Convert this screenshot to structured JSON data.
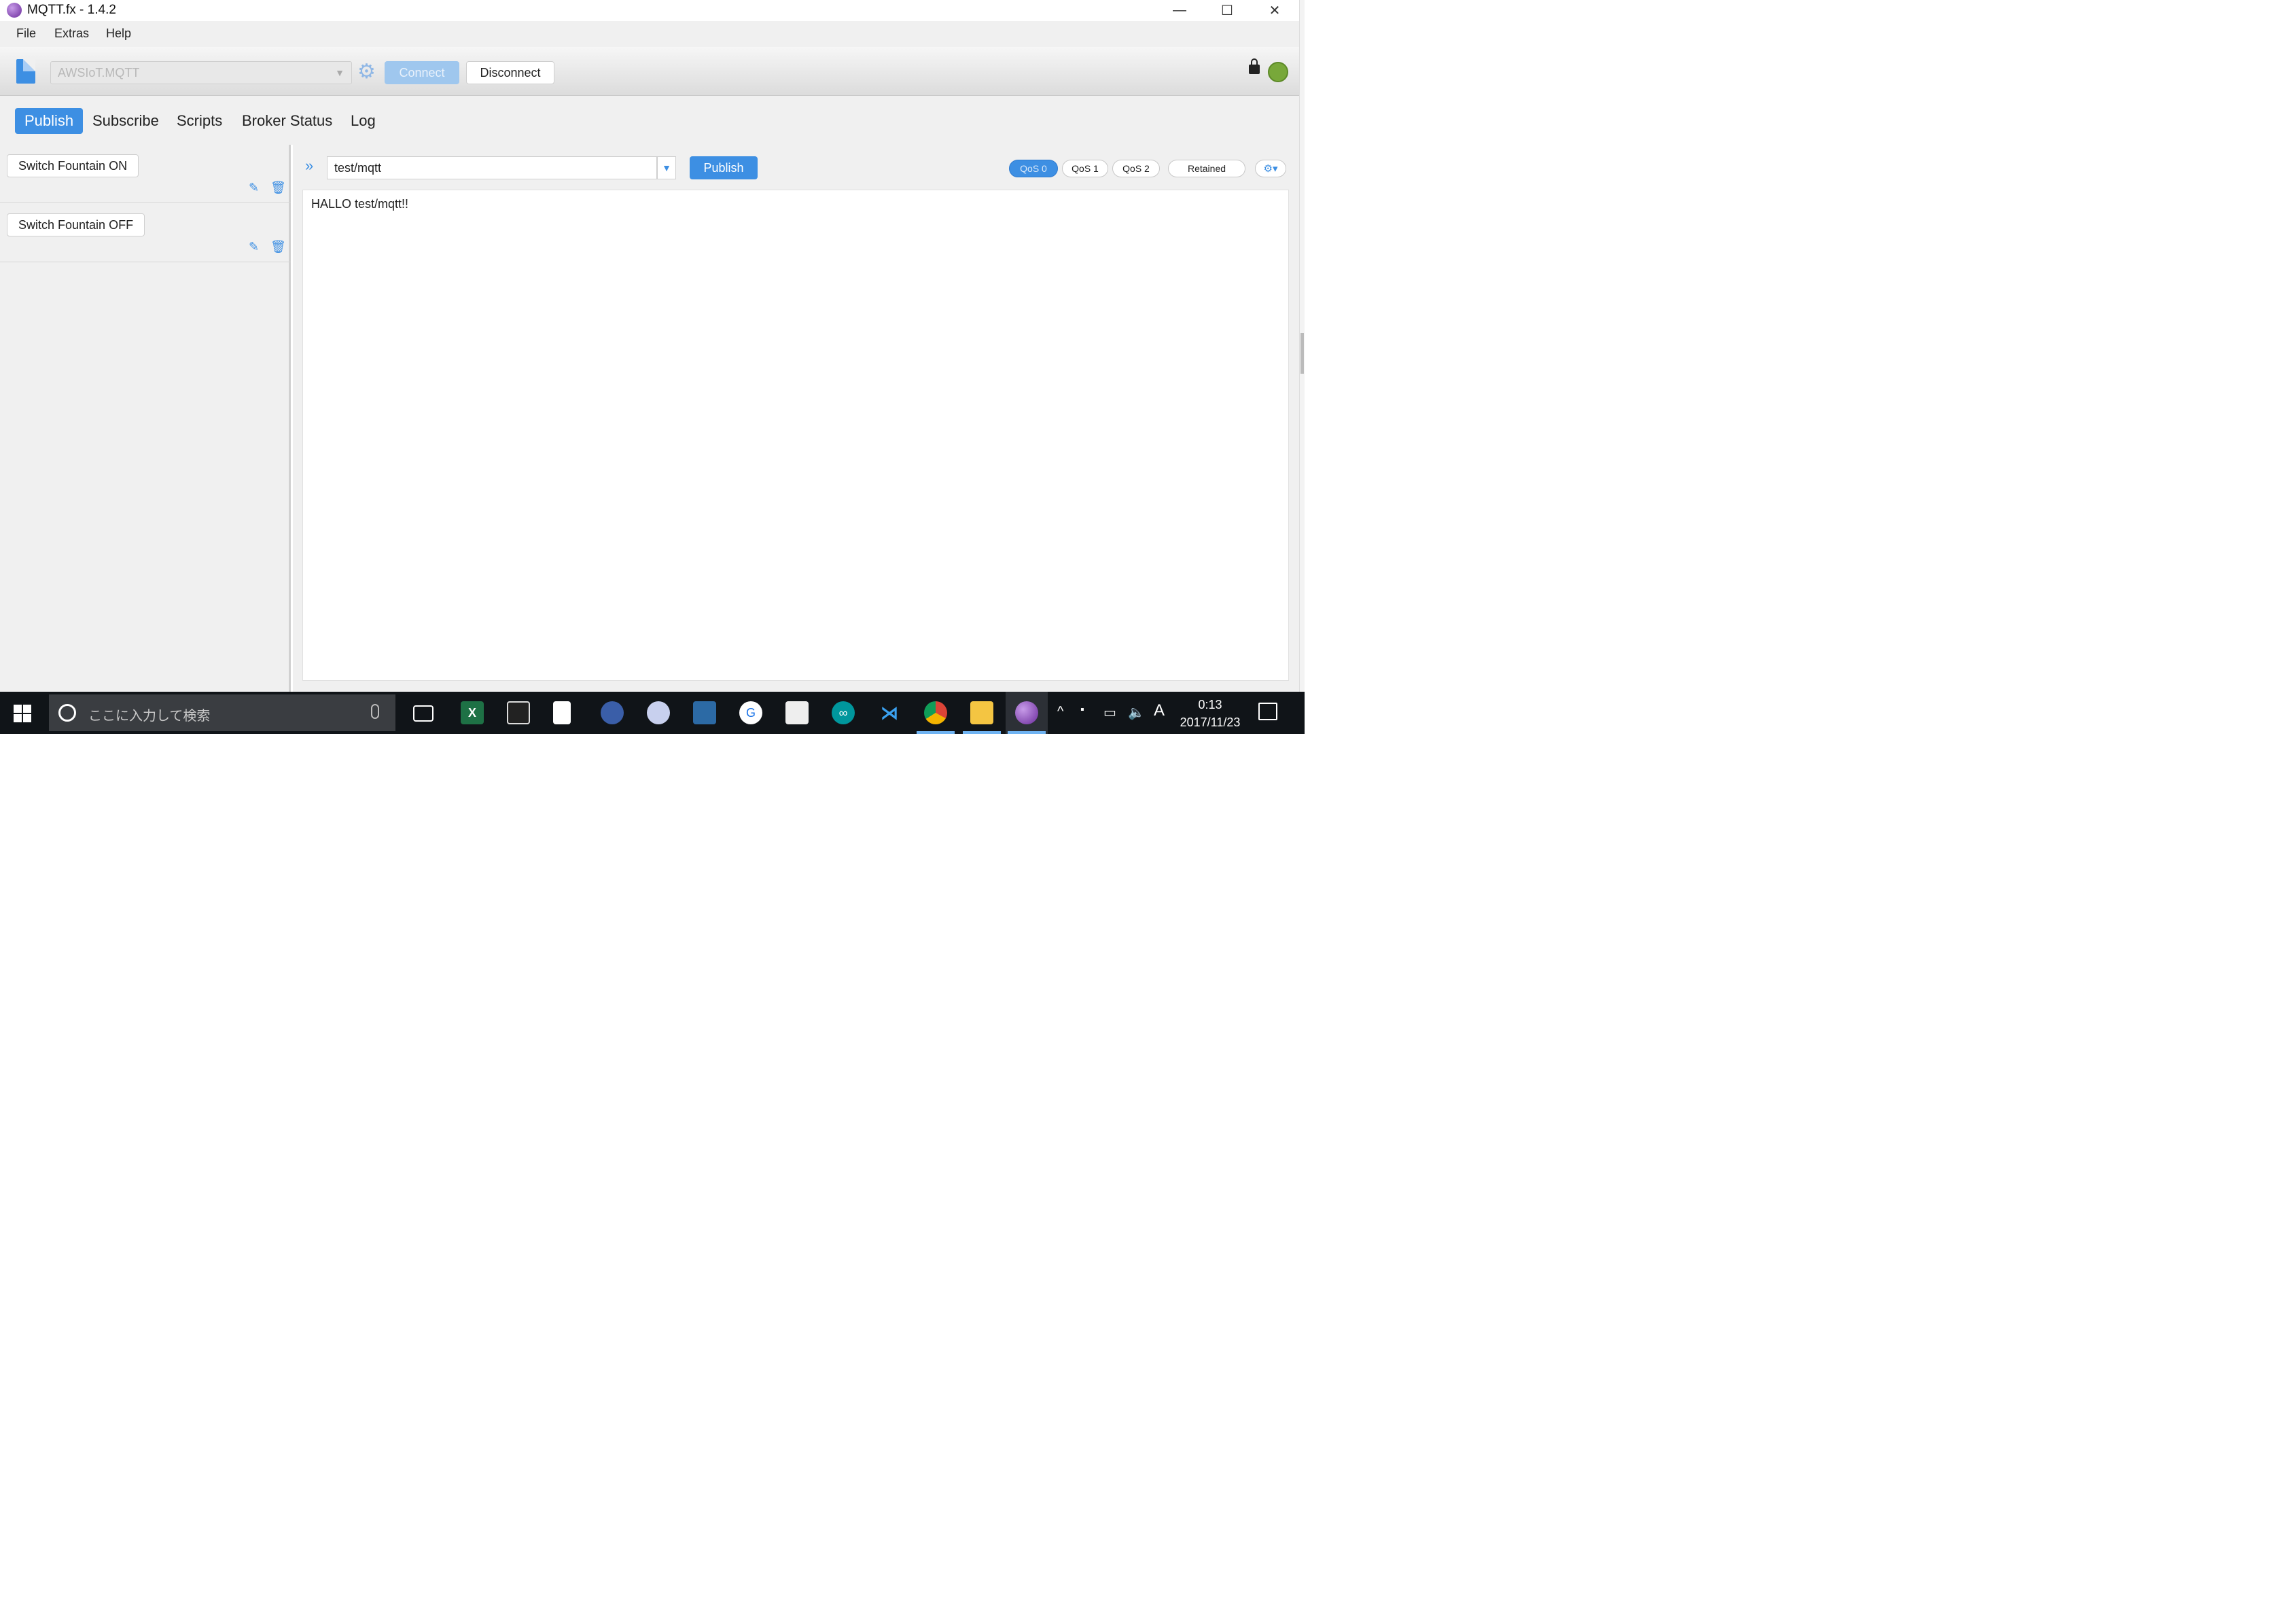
{
  "window": {
    "title": "MQTT.fx - 1.4.2",
    "minimize": "—",
    "maximize": "☐",
    "close": "✕"
  },
  "menu": {
    "items": [
      "File",
      "Extras",
      "Help"
    ]
  },
  "toolbar": {
    "profile": "AWSIoT.MQTT",
    "connect_label": "Connect",
    "disconnect_label": "Disconnect"
  },
  "tabs": [
    "Publish",
    "Subscribe",
    "Scripts",
    "Broker Status",
    "Log"
  ],
  "active_tab": "Publish",
  "saved_messages": [
    {
      "label": "Switch Fountain ON"
    },
    {
      "label": "Switch Fountain OFF"
    }
  ],
  "publish": {
    "topic": "test/mqtt",
    "publish_label": "Publish",
    "qos": [
      "QoS 0",
      "QoS 1",
      "QoS 2"
    ],
    "qos_selected": "QoS 0",
    "retained_label": "Retained",
    "payload": "HALLO test/mqtt!!"
  },
  "taskbar": {
    "search_placeholder": "ここに入力して検索",
    "time": "0:13",
    "date": "2017/11/23",
    "ime": "A"
  },
  "colors": {
    "accent": "#3d8fe3",
    "connected_status": "#78a83a"
  }
}
